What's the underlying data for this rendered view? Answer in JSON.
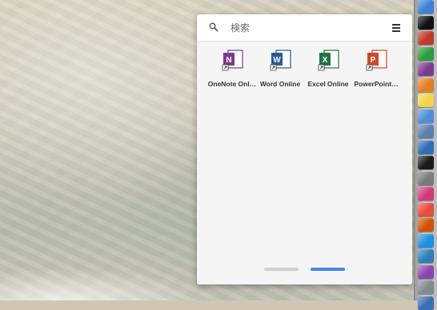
{
  "search": {
    "placeholder": "検索"
  },
  "apps": [
    {
      "label": "OneNote Onl…",
      "letter": "N",
      "color": "#7c3b8f"
    },
    {
      "label": "Word Online",
      "letter": "W",
      "color": "#2b579a"
    },
    {
      "label": "Excel Online",
      "letter": "X",
      "color": "#217346"
    },
    {
      "label": "PowerPoint…",
      "letter": "P",
      "color": "#d24726"
    }
  ],
  "pager": {
    "pages": 2,
    "active_page": 2,
    "active_color": "#4285f4",
    "inactive_color": "#d0d0d0"
  },
  "dock": [
    {
      "name": "safari-icon",
      "color": "#3b82d6"
    },
    {
      "name": "terminal-icon",
      "color": "#111111"
    },
    {
      "name": "tools-icon",
      "color": "#c0392b"
    },
    {
      "name": "evernote-icon",
      "color": "#2d9c40"
    },
    {
      "name": "onenote-icon",
      "color": "#7c3b8f"
    },
    {
      "name": "box-icon",
      "color": "#e67e22"
    },
    {
      "name": "stickies-icon",
      "color": "#f1d54b"
    },
    {
      "name": "remote-desktop-icon",
      "color": "#4a90d9"
    },
    {
      "name": "virtual-machine-icon",
      "color": "#5a7fb0"
    },
    {
      "name": "finder-globe-icon",
      "color": "#2f6fb5"
    },
    {
      "name": "terminal-app-icon",
      "color": "#1a1a1a"
    },
    {
      "name": "printer-icon",
      "color": "#7a7a7a"
    },
    {
      "name": "heart-app-icon",
      "color": "#d23a7a"
    },
    {
      "name": "app-store-icon",
      "color": "#e74c3c"
    },
    {
      "name": "slides-icon",
      "color": "#d35400"
    },
    {
      "name": "ie-browser-icon",
      "color": "#1f8fe0"
    },
    {
      "name": "compass-icon",
      "color": "#2980b9"
    },
    {
      "name": "pencil-app-icon",
      "color": "#8e44ad"
    },
    {
      "name": "settings-icon",
      "color": "#7f8c8d"
    },
    {
      "name": "mail-icon",
      "color": "#3a6fb5"
    }
  ]
}
